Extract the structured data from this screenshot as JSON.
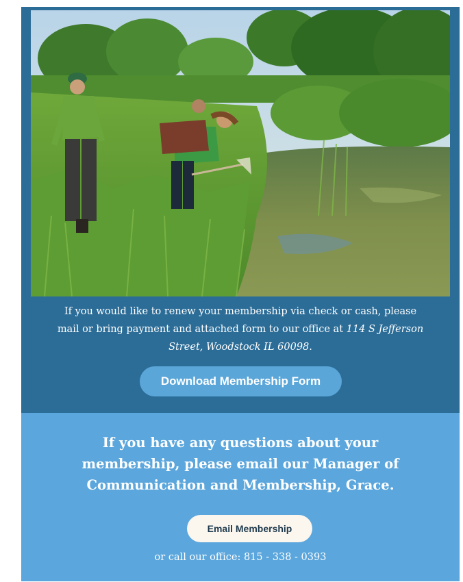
{
  "photo": {
    "alt_subject": "photo-students-in-wetland"
  },
  "renew": {
    "text_before": "If you would like to renew your membership via check or cash, please mail or bring payment and attached form to our office at ",
    "address": "114 S Jefferson Street, Woodstock IL 60098",
    "text_after": "."
  },
  "download_button": {
    "label": "Download Membership Form"
  },
  "questions": {
    "heading": "If you have any questions about your membership, please email our Manager of Communication and Membership, Grace."
  },
  "email_button": {
    "label": "Email Membership"
  },
  "call": {
    "prefix": "or call our office: ",
    "phone": "815 - 338 - 0393"
  },
  "colors": {
    "top_section_bg": "#2c6d98",
    "bottom_section_bg": "#5ba6dc",
    "download_button_bg": "#5aa6d8",
    "email_button_bg": "#fbf7ef"
  }
}
